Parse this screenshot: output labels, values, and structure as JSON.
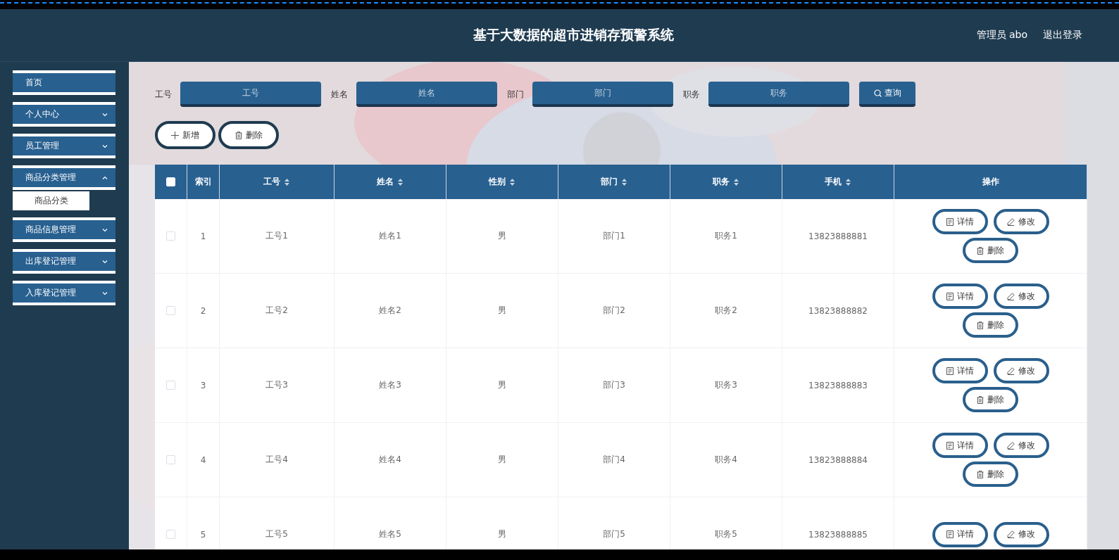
{
  "header": {
    "title": "基于大数据的超市进销存预警系统",
    "user": "管理员 abo",
    "logout": "退出登录"
  },
  "sidebar": {
    "items": [
      {
        "label": "首页",
        "expandable": false
      },
      {
        "label": "个人中心",
        "expandable": true,
        "expanded": false
      },
      {
        "label": "员工管理",
        "expandable": true,
        "expanded": false
      },
      {
        "label": "商品分类管理",
        "expandable": true,
        "expanded": true,
        "children": [
          {
            "label": "商品分类"
          }
        ]
      },
      {
        "label": "商品信息管理",
        "expandable": true,
        "expanded": false
      },
      {
        "label": "出库登记管理",
        "expandable": true,
        "expanded": false
      },
      {
        "label": "入库登记管理",
        "expandable": true,
        "expanded": false
      }
    ]
  },
  "search": {
    "fields": [
      {
        "label": "工号",
        "placeholder": "工号"
      },
      {
        "label": "姓名",
        "placeholder": "姓名"
      },
      {
        "label": "部门",
        "placeholder": "部门"
      },
      {
        "label": "职务",
        "placeholder": "职务"
      }
    ],
    "button": "查询"
  },
  "toolbar": [
    {
      "kind": "add",
      "label": "新增"
    },
    {
      "kind": "delete",
      "label": "删除"
    }
  ],
  "table": {
    "select_all_checked": false,
    "columns": [
      {
        "label": "索引",
        "sortable": false
      },
      {
        "label": "工号",
        "sortable": true
      },
      {
        "label": "姓名",
        "sortable": true
      },
      {
        "label": "性别",
        "sortable": true
      },
      {
        "label": "部门",
        "sortable": true
      },
      {
        "label": "职务",
        "sortable": true
      },
      {
        "label": "手机",
        "sortable": true
      },
      {
        "label": "操作",
        "sortable": false
      }
    ],
    "rows": [
      {
        "checked": false,
        "cells": [
          "1",
          "工号1",
          "姓名1",
          "男",
          "部门1",
          "职务1",
          "13823888881"
        ],
        "actions": [
          {
            "kind": "detail",
            "label": "详情"
          },
          {
            "kind": "edit",
            "label": "修改"
          },
          {
            "kind": "delete",
            "label": "删除"
          }
        ]
      },
      {
        "checked": false,
        "cells": [
          "2",
          "工号2",
          "姓名2",
          "男",
          "部门2",
          "职务2",
          "13823888882"
        ],
        "actions": [
          {
            "kind": "detail",
            "label": "详情"
          },
          {
            "kind": "edit",
            "label": "修改"
          },
          {
            "kind": "delete",
            "label": "删除"
          }
        ]
      },
      {
        "checked": false,
        "cells": [
          "3",
          "工号3",
          "姓名3",
          "男",
          "部门3",
          "职务3",
          "13823888883"
        ],
        "actions": [
          {
            "kind": "detail",
            "label": "详情"
          },
          {
            "kind": "edit",
            "label": "修改"
          },
          {
            "kind": "delete",
            "label": "删除"
          }
        ]
      },
      {
        "checked": false,
        "cells": [
          "4",
          "工号4",
          "姓名4",
          "男",
          "部门4",
          "职务4",
          "13823888884"
        ],
        "actions": [
          {
            "kind": "detail",
            "label": "详情"
          },
          {
            "kind": "edit",
            "label": "修改"
          },
          {
            "kind": "delete",
            "label": "删除"
          }
        ]
      },
      {
        "checked": false,
        "cells": [
          "5",
          "工号5",
          "姓名5",
          "男",
          "部门5",
          "职务5",
          "13823888885"
        ],
        "actions": [
          {
            "kind": "detail",
            "label": "详情"
          },
          {
            "kind": "edit",
            "label": "修改"
          }
        ]
      }
    ]
  }
}
